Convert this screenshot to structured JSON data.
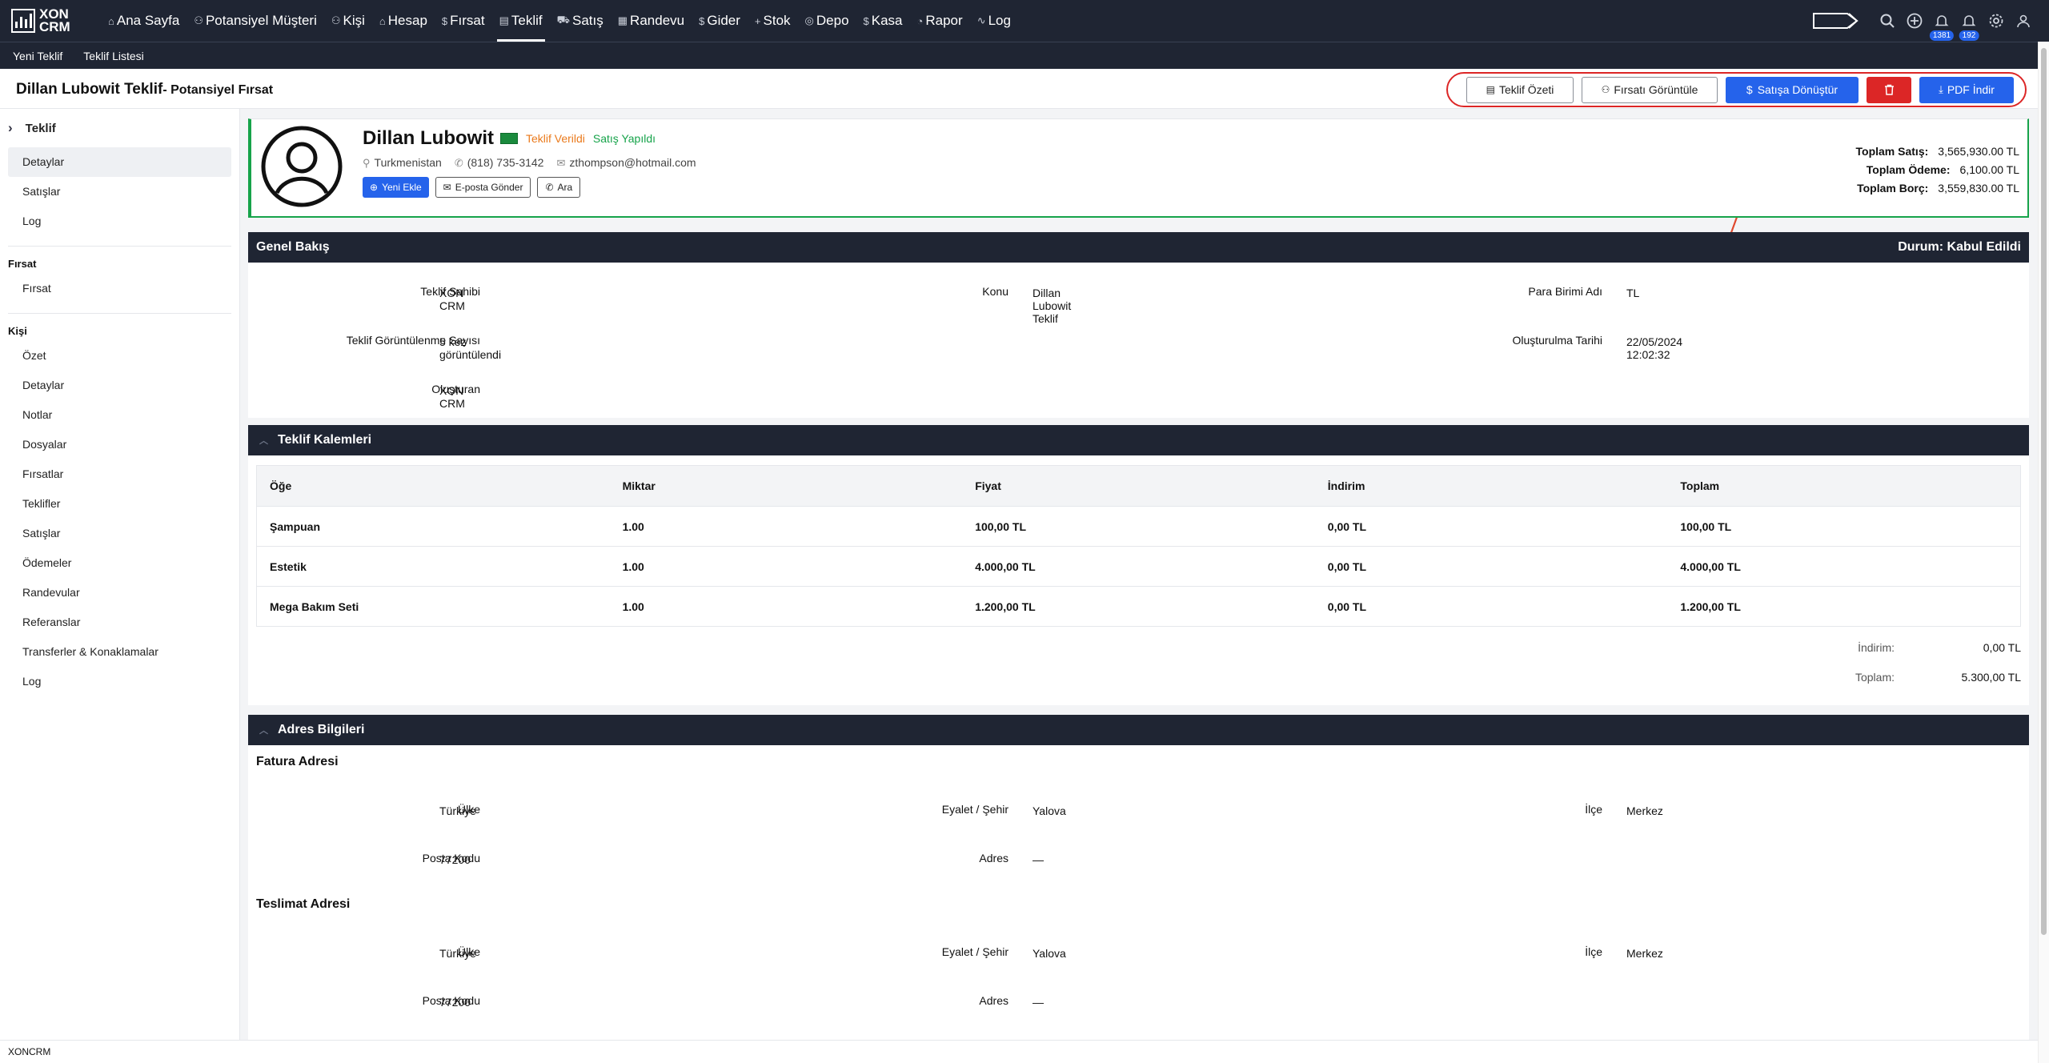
{
  "app": {
    "logo_line1": "XON",
    "logo_line2": "CRM"
  },
  "nav": [
    {
      "icon": "⌂",
      "label": "Ana Sayfa",
      "icon_name": "home-icon"
    },
    {
      "icon": "⚇",
      "label": "Potansiyel Müşteri",
      "icon_name": "user-icon"
    },
    {
      "icon": "⚇",
      "label": "Kişi",
      "icon_name": "users-icon"
    },
    {
      "icon": "⌂",
      "label": "Hesap",
      "icon_name": "building-icon"
    },
    {
      "icon": "$",
      "label": "Fırsat",
      "icon_name": "dollar-icon"
    },
    {
      "icon": "▤",
      "label": "Teklif",
      "icon_name": "document-icon",
      "active": true
    },
    {
      "icon": "⛟",
      "label": "Satış",
      "icon_name": "cart-icon"
    },
    {
      "icon": "▦",
      "label": "Randevu",
      "icon_name": "calendar-icon"
    },
    {
      "icon": "$",
      "label": "Gider",
      "icon_name": "dollar-icon"
    },
    {
      "icon": "+",
      "label": "Stok",
      "icon_name": "plus-icon"
    },
    {
      "icon": "◎",
      "label": "Depo",
      "icon_name": "warehouse-icon"
    },
    {
      "icon": "$",
      "label": "Kasa",
      "icon_name": "dollar-icon"
    },
    {
      "icon": "◔",
      "label": "Rapor",
      "icon_name": "chart-icon"
    },
    {
      "icon": "∿",
      "label": "Log",
      "icon_name": "activity-icon"
    }
  ],
  "topright": {
    "notif1_count": "1381",
    "notif2_count": "192"
  },
  "subnav": {
    "new_quote": "Yeni Teklif",
    "quote_list": "Teklif Listesi"
  },
  "page": {
    "title": "Dillan Lubowit Teklif",
    "subtitle": "- Potansiyel Fırsat"
  },
  "actions": {
    "summary": "Teklif Özeti",
    "view_opportunity": "Fırsatı Görüntüle",
    "convert_to_sale": "Satışa Dönüştür",
    "pdf": "PDF İndir"
  },
  "sidebar": {
    "head": "Teklif",
    "quote_items": [
      "Detaylar",
      "Satışlar",
      "Log"
    ],
    "group_opportunity": "Fırsat",
    "opportunity_items": [
      "Fırsat"
    ],
    "group_person": "Kişi",
    "person_items": [
      "Özet",
      "Detaylar",
      "Notlar",
      "Dosyalar",
      "Fırsatlar",
      "Teklifler",
      "Satışlar",
      "Ödemeler",
      "Randevular",
      "Referanslar",
      "Transferler & Konaklamalar",
      "Log"
    ]
  },
  "profile": {
    "name": "Dillan Lubowit",
    "status1": "Teklif Verildi",
    "status2": "Satış Yapıldı",
    "country": "Turkmenistan",
    "phone": "(818) 735-3142",
    "email": "zthompson@hotmail.com",
    "btn_add": "Yeni Ekle",
    "btn_email": "E-posta Gönder",
    "btn_call": "Ara",
    "totals": [
      {
        "label": "Toplam Satış:",
        "value": "3,565,930.00 TL"
      },
      {
        "label": "Toplam Ödeme:",
        "value": "6,100.00 TL"
      },
      {
        "label": "Toplam Borç:",
        "value": "3,559,830.00 TL"
      }
    ]
  },
  "overview": {
    "title": "Genel Bakış",
    "status_label": "Durum:",
    "status_value": "Kabul Edildi",
    "owner_label": "Teklif Sahibi",
    "owner": "XON CRM",
    "subject_label": "Konu",
    "subject": "Dillan Lubowit Teklif",
    "currency_label": "Para Birimi Adı",
    "currency": "TL",
    "views_label": "Teklif Görüntülenme Sayısı",
    "views": "5 kez görüntülendi",
    "created_label": "Oluşturulma Tarihi",
    "created": "22/05/2024 12:02:32",
    "creator_label": "Oluşturan",
    "creator": "XON CRM"
  },
  "items": {
    "title": "Teklif Kalemleri",
    "headers": [
      "Öğe",
      "Miktar",
      "Fiyat",
      "İndirim",
      "Toplam"
    ],
    "rows": [
      [
        "Şampuan",
        "1.00",
        "100,00 TL",
        "0,00 TL",
        "100,00 TL"
      ],
      [
        "Estetik",
        "1.00",
        "4.000,00 TL",
        "0,00 TL",
        "4.000,00 TL"
      ],
      [
        "Mega Bakım Seti",
        "1.00",
        "1.200,00 TL",
        "0,00 TL",
        "1.200,00 TL"
      ]
    ],
    "discount_label": "İndirim:",
    "discount": "0,00 TL",
    "total_label": "Toplam:",
    "total": "5.300,00 TL"
  },
  "address": {
    "title": "Adres Bilgileri",
    "billing_title": "Fatura Adresi",
    "shipping_title": "Teslimat Adresi",
    "country_label": "Ülke",
    "state_label": "Eyalet / Şehir",
    "district_label": "İlçe",
    "zip_label": "Posta Kodu",
    "addr_label": "Adres",
    "billing": {
      "country": "Türkiye",
      "state": "Yalova",
      "district": "Merkez",
      "zip": "77200",
      "addr": "—"
    },
    "shipping": {
      "country": "Türkiye",
      "state": "Yalova",
      "district": "Merkez",
      "zip": "77200",
      "addr": "—"
    }
  },
  "footer": {
    "text": "XONCRM"
  }
}
